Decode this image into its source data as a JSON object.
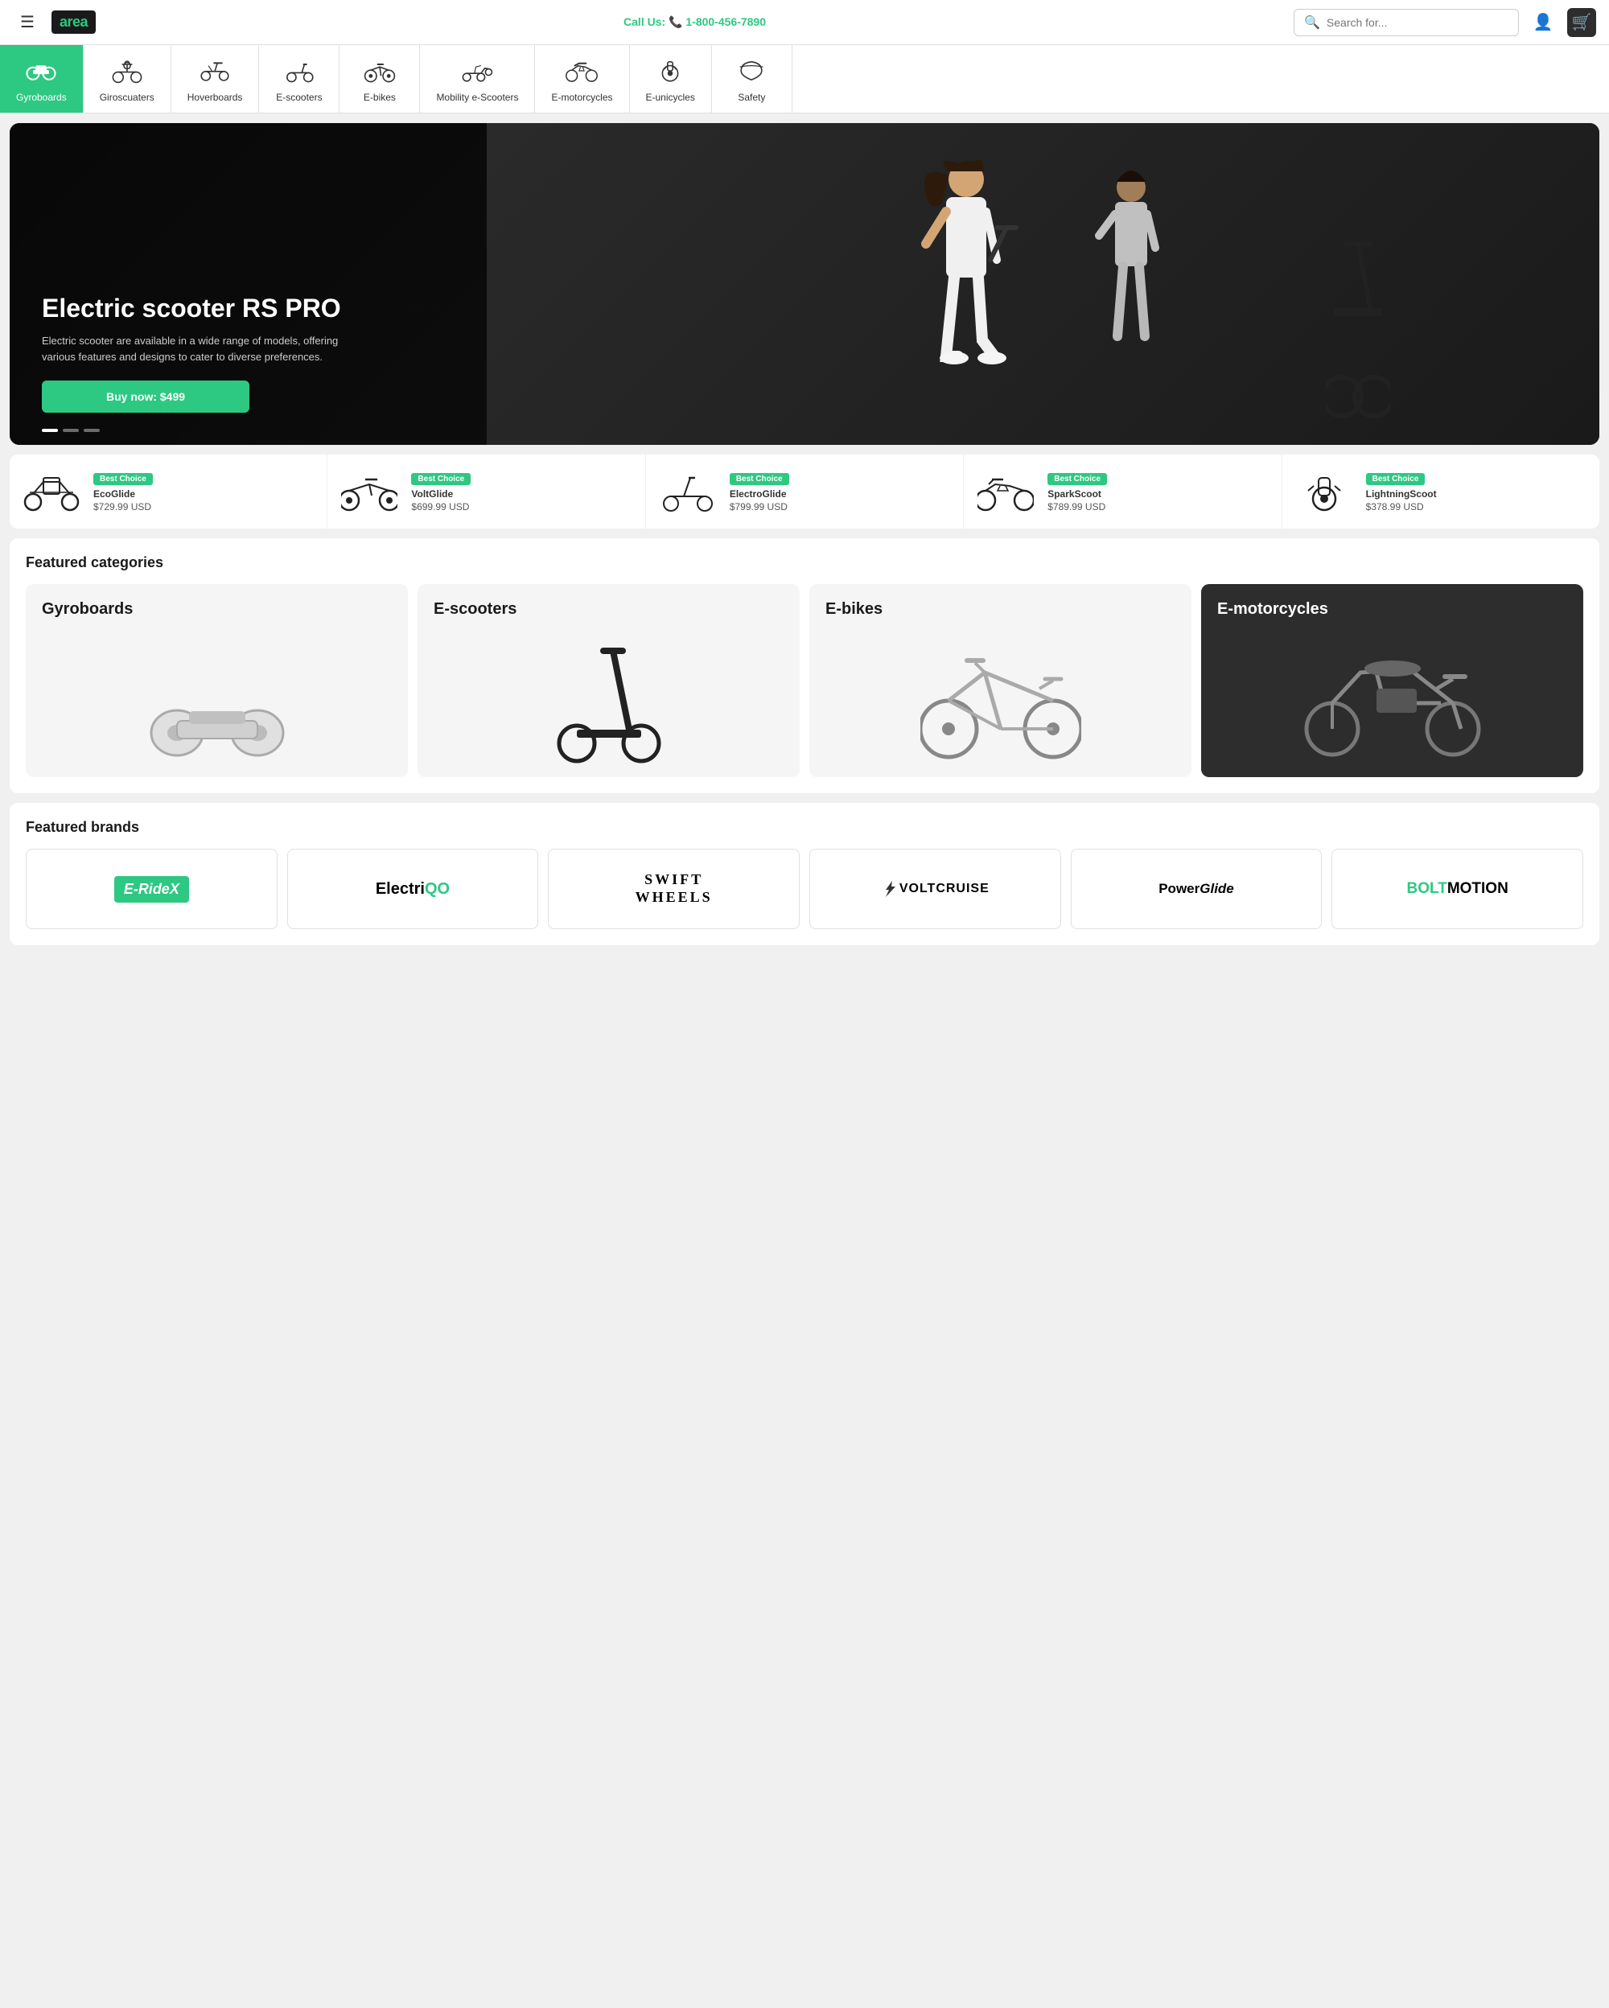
{
  "header": {
    "menu_icon": "☰",
    "logo_text": "area",
    "call_label": "Call Us: 📞 1-800-456-7890",
    "search_placeholder": "Search for...",
    "cart_icon": "🛒",
    "user_icon": "👤"
  },
  "nav_categories": [
    {
      "id": "gyroboards",
      "label": "Gyroboards",
      "active": true
    },
    {
      "id": "giroscuaters",
      "label": "Giroscuaters",
      "active": false
    },
    {
      "id": "hoverboards",
      "label": "Hoverboards",
      "active": false
    },
    {
      "id": "e-scooters",
      "label": "E-scooters",
      "active": false
    },
    {
      "id": "e-bikes",
      "label": "E-bikes",
      "active": false
    },
    {
      "id": "mobility-e-scooters",
      "label": "Mobility e-Scooters",
      "active": false
    },
    {
      "id": "e-motorcycles",
      "label": "E-motorcycles",
      "active": false
    },
    {
      "id": "e-unicycles",
      "label": "E-unicycles",
      "active": false
    },
    {
      "id": "safety",
      "label": "Safety",
      "active": false
    }
  ],
  "hero": {
    "title": "Electric scooter RS PRO",
    "description": "Electric scooter are available in a wide range of models, offering various features and designs to cater to diverse preferences.",
    "button_label": "Buy now: $499"
  },
  "hero_dots": [
    true,
    false,
    false
  ],
  "products": [
    {
      "badge": "Best Choice",
      "name": "EcoGlide",
      "price": "$729.99 USD"
    },
    {
      "badge": "Best Choice",
      "name": "VoltGlide",
      "price": "$699.99 USD"
    },
    {
      "badge": "Best Choice",
      "name": "ElectroGlide",
      "price": "$799.99 USD"
    },
    {
      "badge": "Best Choice",
      "name": "SparkScoot",
      "price": "$789.99 USD"
    },
    {
      "badge": "Best Choice",
      "name": "LightningScoot",
      "price": "$378.99 USD"
    }
  ],
  "featured_categories": {
    "title": "Featured categories",
    "items": [
      {
        "name": "Gyroboards",
        "dark": false
      },
      {
        "name": "E-scooters",
        "dark": false
      },
      {
        "name": "E-bikes",
        "dark": false
      },
      {
        "name": "E-motorcycles",
        "dark": true
      }
    ]
  },
  "featured_brands": {
    "title": "Featured brands",
    "items": [
      {
        "name": "E-RideX",
        "style": "eridex"
      },
      {
        "name": "ElectriQO",
        "style": "electrigo"
      },
      {
        "name": "SWIFT WHEELS",
        "style": "swift"
      },
      {
        "name": "VOLTCRUISE",
        "style": "voltcruise"
      },
      {
        "name": "PowerGlide",
        "style": "powerglide"
      },
      {
        "name": "BOLTMOTION",
        "style": "boltmotion"
      }
    ]
  }
}
